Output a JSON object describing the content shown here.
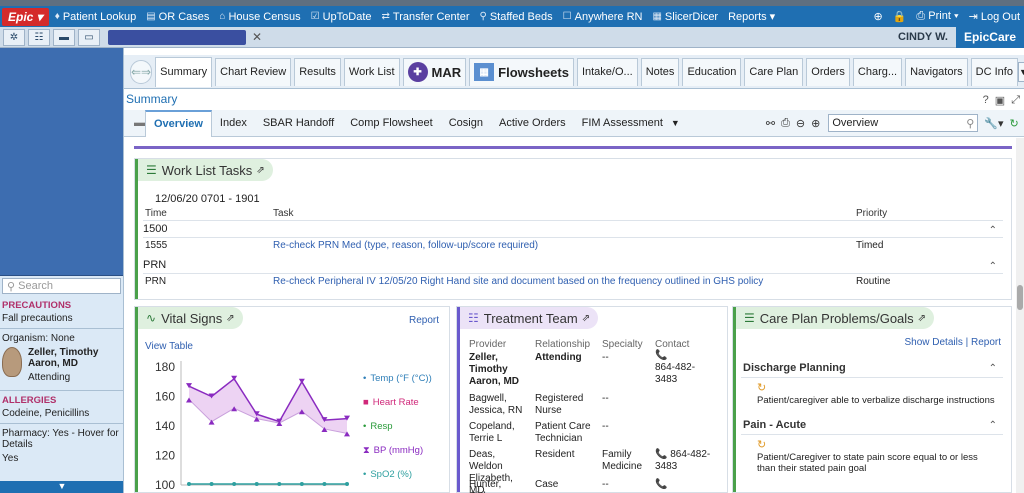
{
  "menubar": {
    "epic": "Epic",
    "items": [
      {
        "label": "Patient Lookup",
        "icon": "patient-lookup-icon"
      },
      {
        "label": "OR Cases",
        "icon": "or-cases-icon"
      },
      {
        "label": "House Census",
        "icon": "house-census-icon"
      },
      {
        "label": "UpToDate",
        "icon": "uptodate-icon"
      },
      {
        "label": "Transfer Center",
        "icon": "transfer-center-icon"
      },
      {
        "label": "Staffed Beds",
        "icon": "staffed-beds-icon"
      },
      {
        "label": "Anywhere RN",
        "icon": "anywhere-rn-icon"
      },
      {
        "label": "SlicerDicer",
        "icon": "slicerdicer-icon"
      },
      {
        "label": "Reports ▾",
        "icon": ""
      }
    ],
    "print": "Print ▾",
    "logout": "Log Out"
  },
  "toolbar2": {
    "user": "CINDY W.",
    "app": "EpicCare"
  },
  "left": {
    "search_placeholder": "Search",
    "precautions_label": "PRECAUTIONS",
    "precautions_val": "Fall precautions",
    "organism": "Organism: None",
    "provider_name": "Zeller, Timothy Aaron, MD",
    "provider_role": "Attending",
    "allergies_label": "ALLERGIES",
    "allergies_val": "Codeine, Penicillins",
    "pharmacy": "Pharmacy: Yes - Hover for Details",
    "yes": "Yes"
  },
  "nav": {
    "tabs": [
      "Summary",
      "Chart Review",
      "Results",
      "Work List",
      "MAR",
      "Flowsheets",
      "Intake/O...",
      "Notes",
      "Education",
      "Care Plan",
      "Orders",
      "Charg...",
      "Navigators",
      "DC Info"
    ]
  },
  "summary": {
    "title": "Summary",
    "subtabs": [
      "Overview",
      "Index",
      "SBAR Handoff",
      "Comp Flowsheet",
      "Cosign",
      "Active Orders",
      "FIM Assessment"
    ],
    "search_value": "Overview"
  },
  "worklist": {
    "title": "Work List Tasks",
    "date": "12/06/20 0701 - 1901",
    "cols": {
      "time": "Time",
      "task": "Task",
      "priority": "Priority"
    },
    "groups": [
      {
        "name": "1500",
        "rows": [
          {
            "time": "1555",
            "task": "Re-check PRN Med (type, reason, follow-up/score required)",
            "priority": "Timed"
          }
        ]
      },
      {
        "name": "PRN",
        "rows": [
          {
            "time": "PRN",
            "task": "Re-check Peripheral IV 12/05/20 Right Hand site and document based on the frequency outlined in GHS policy",
            "priority": "Routine"
          }
        ]
      }
    ]
  },
  "vitals": {
    "title": "Vital Signs",
    "report": "Report",
    "view_table": "View Table",
    "legend": [
      {
        "label": "Temp (°F (°C))",
        "color": "#2f7fb8",
        "marker": "•"
      },
      {
        "label": "Heart Rate",
        "color": "#d0287a",
        "marker": "■"
      },
      {
        "label": "Resp",
        "color": "#2a9a3a",
        "marker": "•"
      },
      {
        "label": "BP (mmHg)",
        "color": "#8a2bc0",
        "marker": "⧗"
      },
      {
        "label": "SpO2 (%)",
        "color": "#2fa0a0",
        "marker": "•"
      }
    ]
  },
  "chart_data": {
    "type": "line",
    "x": [
      1,
      2,
      3,
      4,
      5,
      6,
      7,
      8
    ],
    "series": [
      {
        "name": "BP (mmHg)",
        "systolic": [
          167,
          160,
          172,
          148,
          143,
          170,
          144,
          145
        ],
        "diastolic": [
          158,
          143,
          152,
          145,
          142,
          150,
          138,
          135
        ],
        "color": "#8a2bc0"
      },
      {
        "name": "SpO2 (%)",
        "values": [
          100,
          100,
          100,
          100,
          100,
          100,
          100,
          100
        ],
        "color": "#2fa0a0"
      }
    ],
    "yticks": [
      100,
      120,
      140,
      160,
      180
    ],
    "ylim": [
      100,
      180
    ]
  },
  "team": {
    "title": "Treatment Team",
    "cols": [
      "Provider",
      "Relationship",
      "Specialty",
      "Contact"
    ],
    "rows": [
      {
        "provider": "Zeller, Timothy Aaron, MD",
        "rel": "Attending",
        "spec": "--",
        "contact": "864-482-3483"
      },
      {
        "provider": "Bagwell, Jessica, RN",
        "rel": "Registered Nurse",
        "spec": "--",
        "contact": ""
      },
      {
        "provider": "Copeland, Terrie L",
        "rel": "Patient Care Technician",
        "spec": "--",
        "contact": ""
      },
      {
        "provider": "Deas, Weldon Elizabeth, MD",
        "rel": "Resident",
        "spec": "Family Medicine",
        "contact": "864-482-3483"
      },
      {
        "provider": "Hunter, Cicley",
        "rel": "Case",
        "spec": "--",
        "contact": ""
      }
    ]
  },
  "careplan": {
    "title": "Care Plan Problems/Goals",
    "show_details": "Show Details",
    "report": "Report",
    "sections": [
      {
        "name": "Discharge Planning",
        "goal": "Patient/caregiver able to verbalize discharge instructions"
      },
      {
        "name": "Pain - Acute",
        "goal": "Patient/Caregiver to state pain score equal to or less than their stated pain goal"
      }
    ]
  }
}
